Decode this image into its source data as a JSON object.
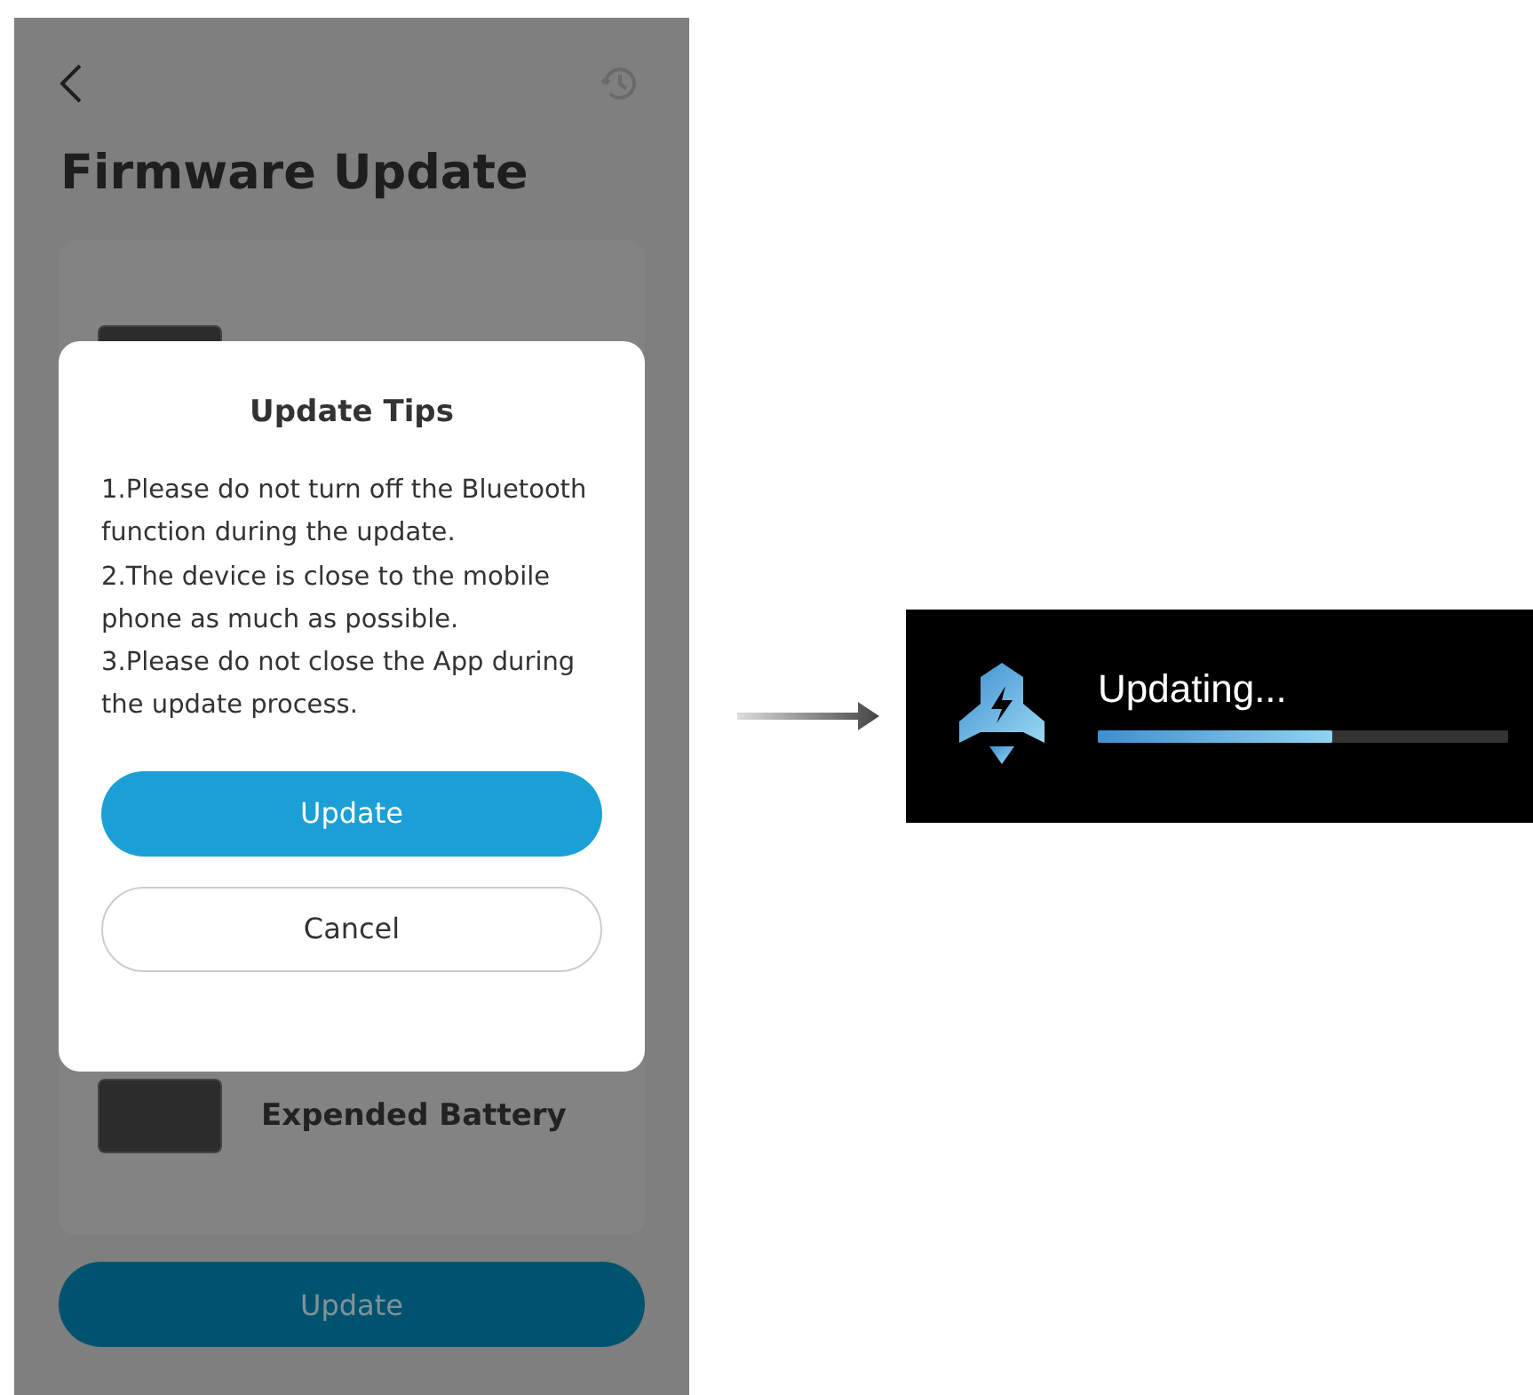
{
  "screen": {
    "title": "Firmware Update",
    "devices": [
      {
        "name": "Expended Battery"
      }
    ],
    "update_button": "Update"
  },
  "dialog": {
    "title": "Update Tips",
    "tips": [
      "1.Please do not turn off the Bluetooth function during the update.",
      "2.The device is close to the mobile phone as much as possible.",
      "3.Please do not close the App during the update process."
    ],
    "buttons": [
      {
        "label": "Update",
        "kind": "primary"
      },
      {
        "label": "Cancel",
        "kind": "secondary"
      }
    ]
  },
  "progress": {
    "label": "Updating...",
    "level": 0.57
  }
}
